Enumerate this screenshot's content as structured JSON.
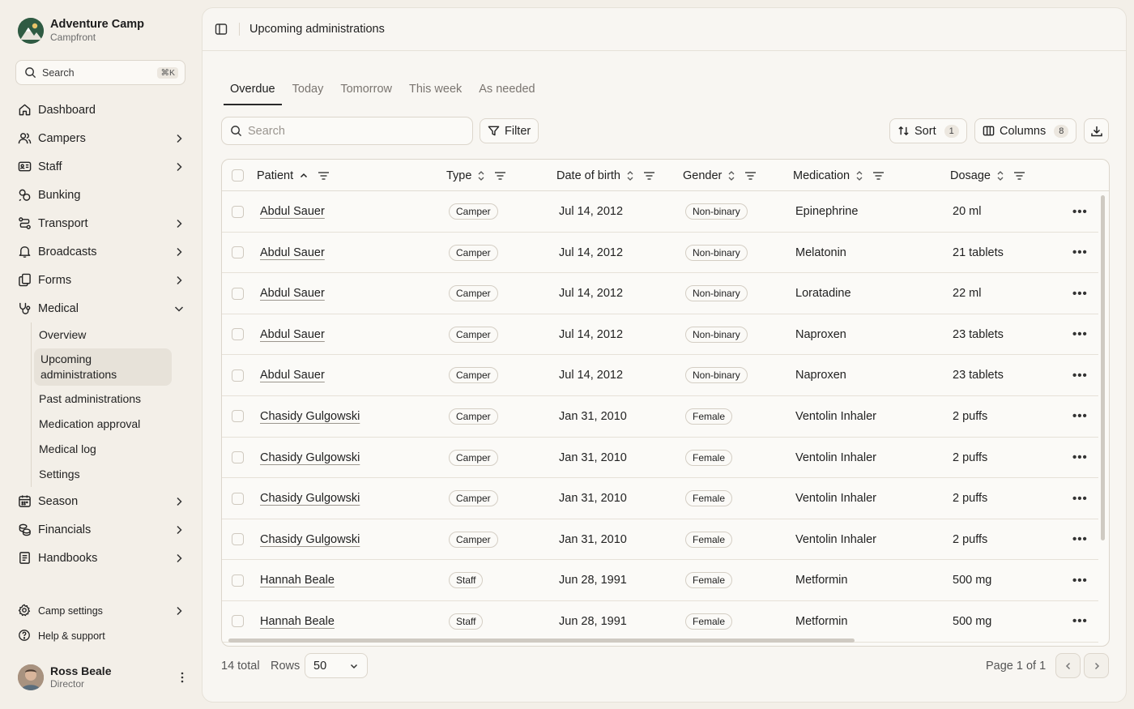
{
  "brand": {
    "name": "Adventure Camp",
    "sub": "Campfront"
  },
  "sidebar": {
    "search_placeholder": "Search",
    "search_shortcut": "⌘K",
    "items": [
      {
        "label": "Dashboard",
        "icon": "home-icon",
        "chevron": false
      },
      {
        "label": "Campers",
        "icon": "users-icon",
        "chevron": true
      },
      {
        "label": "Staff",
        "icon": "id-card-icon",
        "chevron": true
      },
      {
        "label": "Bunking",
        "icon": "bunk-icon",
        "chevron": false
      },
      {
        "label": "Transport",
        "icon": "route-icon",
        "chevron": true
      },
      {
        "label": "Broadcasts",
        "icon": "bell-icon",
        "chevron": true
      },
      {
        "label": "Forms",
        "icon": "forms-icon",
        "chevron": true
      },
      {
        "label": "Medical",
        "icon": "stethoscope-icon",
        "chevron": true,
        "expanded": true
      }
    ],
    "medical_sub": [
      "Overview",
      "Upcoming administrations",
      "Past administrations",
      "Medication approval",
      "Medical log",
      "Settings"
    ],
    "items_after": [
      {
        "label": "Season",
        "icon": "calendar-icon",
        "chevron": true
      },
      {
        "label": "Financials",
        "icon": "coins-icon",
        "chevron": true
      },
      {
        "label": "Handbooks",
        "icon": "book-icon",
        "chevron": true
      }
    ],
    "bottom": [
      {
        "label": "Camp settings",
        "icon": "gear-icon",
        "chevron": true
      },
      {
        "label": "Help & support",
        "icon": "help-icon",
        "chevron": false
      }
    ],
    "profile": {
      "name": "Ross Beale",
      "role": "Director"
    }
  },
  "header": {
    "title": "Upcoming administrations"
  },
  "tabs": [
    "Overdue",
    "Today",
    "Tomorrow",
    "This week",
    "As needed"
  ],
  "toolbar": {
    "search_placeholder": "Search",
    "filter_label": "Filter",
    "sort_label": "Sort",
    "sort_count": "1",
    "columns_label": "Columns",
    "columns_count": "8"
  },
  "table": {
    "columns": [
      "Patient",
      "Type",
      "Date of birth",
      "Gender",
      "Medication",
      "Dosage"
    ],
    "rows": [
      {
        "patient": "Abdul Sauer",
        "type": "Camper",
        "dob": "Jul 14, 2012",
        "gender": "Non-binary",
        "medication": "Epinephrine",
        "dosage": "20 ml"
      },
      {
        "patient": "Abdul Sauer",
        "type": "Camper",
        "dob": "Jul 14, 2012",
        "gender": "Non-binary",
        "medication": "Melatonin",
        "dosage": "21 tablets"
      },
      {
        "patient": "Abdul Sauer",
        "type": "Camper",
        "dob": "Jul 14, 2012",
        "gender": "Non-binary",
        "medication": "Loratadine",
        "dosage": "22 ml"
      },
      {
        "patient": "Abdul Sauer",
        "type": "Camper",
        "dob": "Jul 14, 2012",
        "gender": "Non-binary",
        "medication": "Naproxen",
        "dosage": "23 tablets"
      },
      {
        "patient": "Abdul Sauer",
        "type": "Camper",
        "dob": "Jul 14, 2012",
        "gender": "Non-binary",
        "medication": "Naproxen",
        "dosage": "23 tablets"
      },
      {
        "patient": "Chasidy Gulgowski",
        "type": "Camper",
        "dob": "Jan 31, 2010",
        "gender": "Female",
        "medication": "Ventolin Inhaler",
        "dosage": "2 puffs"
      },
      {
        "patient": "Chasidy Gulgowski",
        "type": "Camper",
        "dob": "Jan 31, 2010",
        "gender": "Female",
        "medication": "Ventolin Inhaler",
        "dosage": "2 puffs"
      },
      {
        "patient": "Chasidy Gulgowski",
        "type": "Camper",
        "dob": "Jan 31, 2010",
        "gender": "Female",
        "medication": "Ventolin Inhaler",
        "dosage": "2 puffs"
      },
      {
        "patient": "Chasidy Gulgowski",
        "type": "Camper",
        "dob": "Jan 31, 2010",
        "gender": "Female",
        "medication": "Ventolin Inhaler",
        "dosage": "2 puffs"
      },
      {
        "patient": "Hannah Beale",
        "type": "Staff",
        "dob": "Jun 28, 1991",
        "gender": "Female",
        "medication": "Metformin",
        "dosage": "500 mg"
      },
      {
        "patient": "Hannah Beale",
        "type": "Staff",
        "dob": "Jun 28, 1991",
        "gender": "Female",
        "medication": "Metformin",
        "dosage": "500 mg"
      }
    ],
    "row_action": "•••"
  },
  "footer": {
    "total": "14 total",
    "rows_label": "Rows",
    "rows_value": "50",
    "page_info": "Page 1 of 1"
  }
}
